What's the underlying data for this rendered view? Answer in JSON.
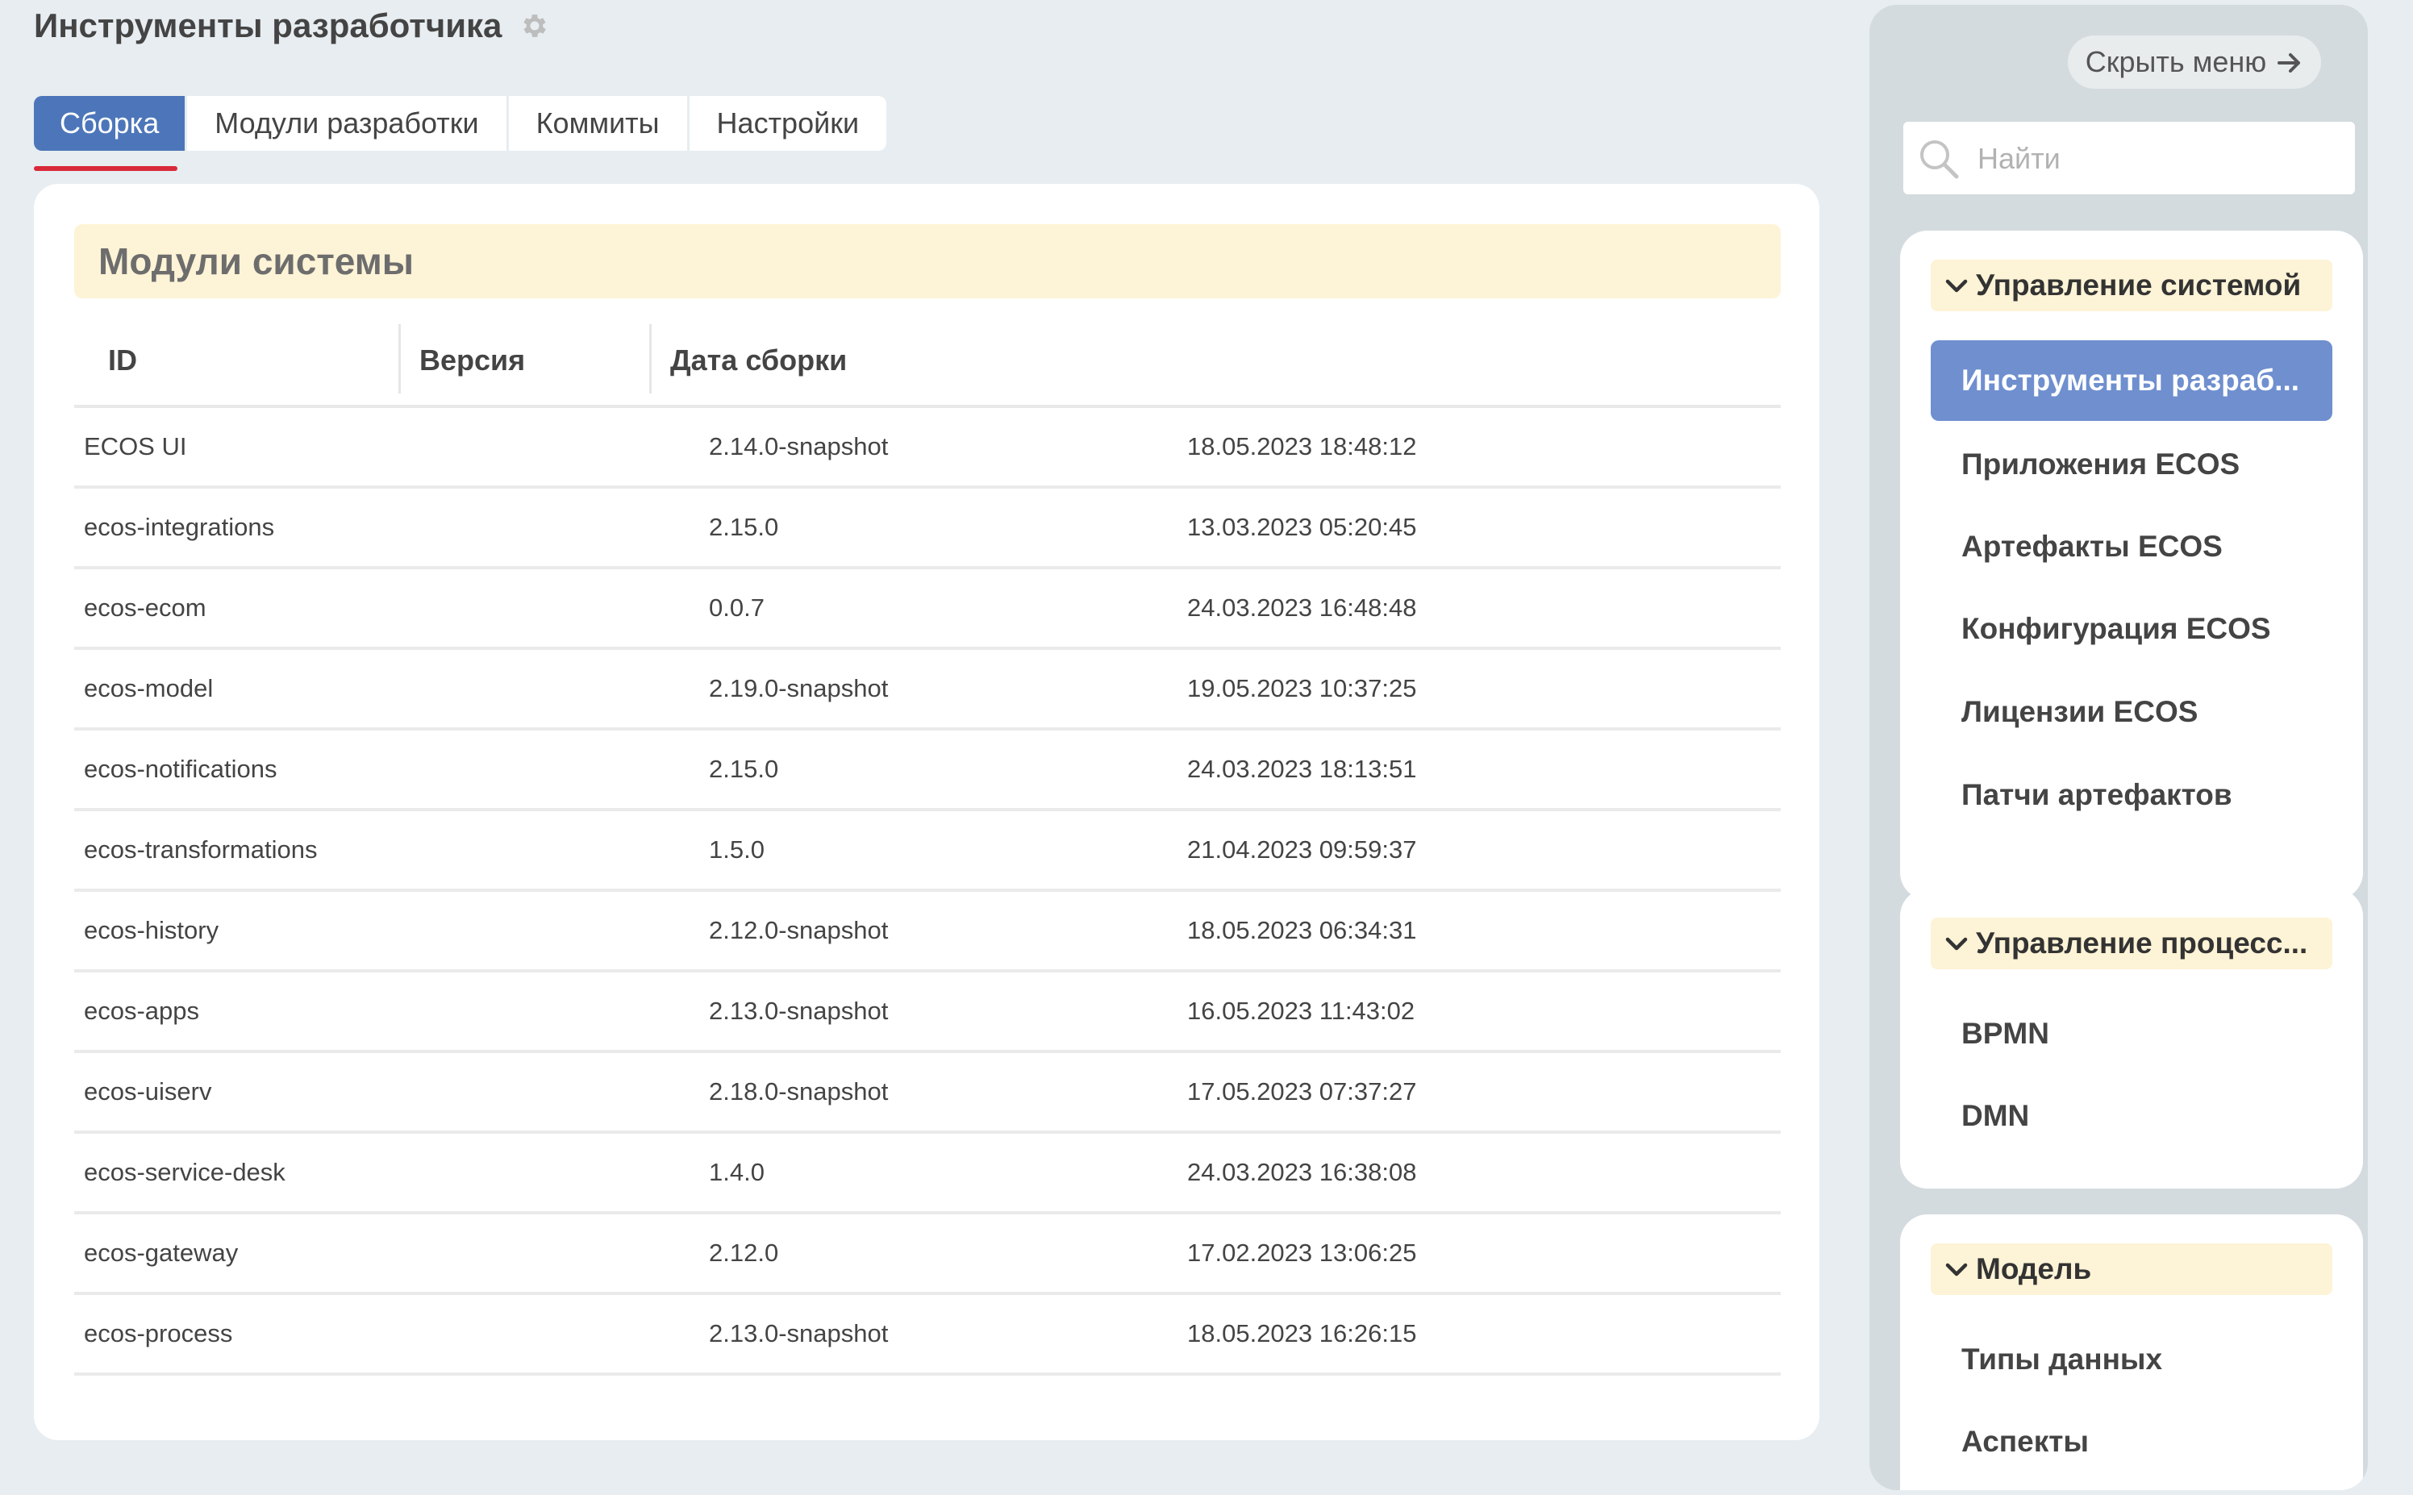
{
  "page": {
    "title": "Инструменты разработчика",
    "settings_icon": "gear-icon"
  },
  "tabs": [
    {
      "label": "Сборка",
      "active": true
    },
    {
      "label": "Модули разработки",
      "active": false
    },
    {
      "label": "Коммиты",
      "active": false
    },
    {
      "label": "Настройки",
      "active": false
    }
  ],
  "modules": {
    "title": "Модули системы",
    "columns": [
      "ID",
      "Версия",
      "Дата сборки"
    ],
    "rows": [
      [
        "ECOS UI",
        "2.14.0-snapshot",
        "18.05.2023 18:48:12"
      ],
      [
        "ecos-integrations",
        "2.15.0",
        "13.03.2023 05:20:45"
      ],
      [
        "ecos-ecom",
        "0.0.7",
        "24.03.2023 16:48:48"
      ],
      [
        "ecos-model",
        "2.19.0-snapshot",
        "19.05.2023 10:37:25"
      ],
      [
        "ecos-notifications",
        "2.15.0",
        "24.03.2023 18:13:51"
      ],
      [
        "ecos-transformations",
        "1.5.0",
        "21.04.2023 09:59:37"
      ],
      [
        "ecos-history",
        "2.12.0-snapshot",
        "18.05.2023 06:34:31"
      ],
      [
        "ecos-apps",
        "2.13.0-snapshot",
        "16.05.2023 11:43:02"
      ],
      [
        "ecos-uiserv",
        "2.18.0-snapshot",
        "17.05.2023 07:37:27"
      ],
      [
        "ecos-service-desk",
        "1.4.0",
        "24.03.2023 16:38:08"
      ],
      [
        "ecos-gateway",
        "2.12.0",
        "17.02.2023 13:06:25"
      ],
      [
        "ecos-process",
        "2.13.0-snapshot",
        "18.05.2023 16:26:15"
      ]
    ]
  },
  "sidebar": {
    "hide_label": "Скрыть меню",
    "hide_icon": "arrow-right-icon",
    "search_placeholder": "Найти",
    "search_icon": "search-icon",
    "sections": [
      {
        "title": "Управление системой",
        "items": [
          {
            "label": "Инструменты разраб...",
            "active": true
          },
          {
            "label": "Приложения ECOS",
            "active": false
          },
          {
            "label": "Артефакты ECOS",
            "active": false
          },
          {
            "label": "Конфигурация ECOS",
            "active": false
          },
          {
            "label": "Лицензии ECOS",
            "active": false
          },
          {
            "label": "Патчи артефактов",
            "active": false
          }
        ]
      },
      {
        "title": "Управление процесс...",
        "items": [
          {
            "label": "BPMN",
            "active": false
          },
          {
            "label": "DMN",
            "active": false
          }
        ]
      },
      {
        "title": "Модель",
        "items": [
          {
            "label": "Типы данных",
            "active": false
          },
          {
            "label": "Аспекты",
            "active": false
          }
        ]
      }
    ]
  },
  "colors": {
    "accent": "#4d76ba",
    "active_menu": "#6f8fcf",
    "header_band": "#fdf3d6",
    "tab_indicator": "#d8293a",
    "page_bg": "#e7edf0"
  }
}
